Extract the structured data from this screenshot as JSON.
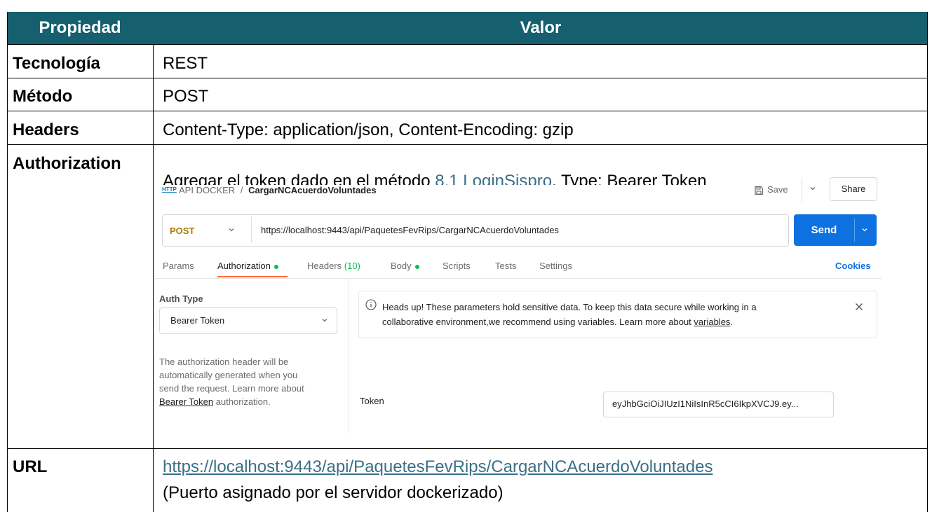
{
  "table": {
    "header": {
      "property": "Propiedad",
      "value": "Valor"
    },
    "rows": {
      "tecnologia": {
        "label": "Tecnología",
        "value": "REST"
      },
      "metodo": {
        "label": "Método",
        "value": "POST"
      },
      "headers": {
        "label": "Headers",
        "value": "Content-Type: application/json, Content-Encoding: gzip"
      },
      "authorization": {
        "label": "Authorization",
        "text_before": "Agregar el token dado en el método ",
        "link": "8.1 LoginSispro",
        "text_after": ", Type: Bearer Token"
      },
      "url": {
        "label": "URL",
        "link": "https://localhost:9443/api/PaquetesFevRips/CargarNCAcuerdoVoluntades",
        "note": "(Puerto asignado por el servidor dockerizado)"
      }
    }
  },
  "postman": {
    "http_badge": "HTTP",
    "breadcrumb": {
      "collection": "API DOCKER",
      "separator": "/",
      "request": "CargarNCAcuerdoVoluntades"
    },
    "save_label": "Save",
    "share_label": "Share",
    "method": "POST",
    "url": "https://localhost:9443/api/PaquetesFevRips/CargarNCAcuerdoVoluntades",
    "send_label": "Send",
    "tabs": {
      "params": "Params",
      "authorization": "Authorization",
      "headers": "Headers",
      "headers_count": "(10)",
      "body": "Body",
      "scripts": "Scripts",
      "tests": "Tests",
      "settings": "Settings"
    },
    "cookies_label": "Cookies",
    "auth_type_label": "Auth Type",
    "auth_type_value": "Bearer Token",
    "helper": {
      "line1": "The authorization header will be",
      "line2": "automatically generated when you",
      "line3": "send the request. Learn more about",
      "link": "Bearer Token",
      "line4_after": " authorization."
    },
    "notice": {
      "line1": "Heads up! These parameters hold sensitive data. To keep this data secure while working in a",
      "line2_before": "collaborative environment,we recommend using variables. Learn more about ",
      "link": "variables",
      "line2_after": "."
    },
    "token_label": "Token",
    "token_value": "eyJhbGciOiJIUzI1NiIsInR5cCI6IkpXVCJ9.ey..."
  },
  "colors": {
    "header_bg": "#155f6e",
    "send_blue": "#0d72e0",
    "post_orange": "#ad7a03",
    "tab_accent": "#ff6c37",
    "green_dot": "#0cbb52",
    "link": "#3a6f88"
  }
}
